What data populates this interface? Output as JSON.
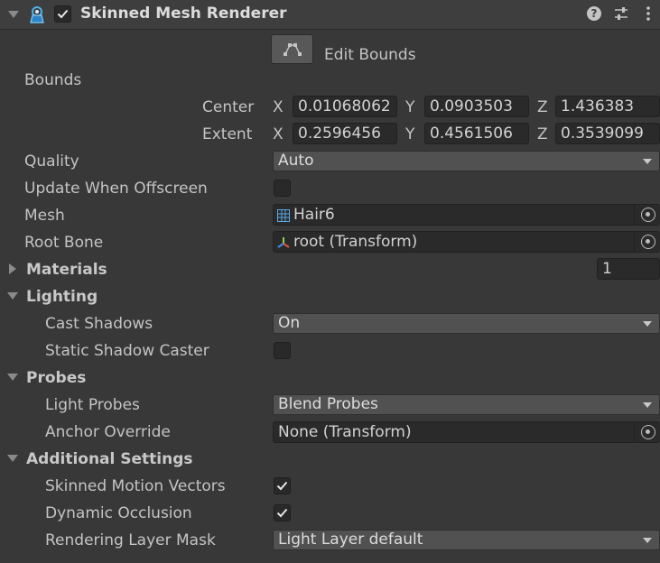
{
  "component": {
    "title": "Skinned Mesh Renderer",
    "enabled": true,
    "header_icons": [
      "help-icon",
      "presets-icon",
      "context-menu-icon"
    ]
  },
  "edit_bounds": {
    "label": "Edit Bounds"
  },
  "bounds": {
    "label": "Bounds",
    "center": {
      "label": "Center",
      "x_label": "X",
      "y_label": "Y",
      "z_label": "Z",
      "x": "0.01068062",
      "y": "0.0903503",
      "z": "1.436383"
    },
    "extent": {
      "label": "Extent",
      "x_label": "X",
      "y_label": "Y",
      "z_label": "Z",
      "x": "0.2596456",
      "y": "0.4561506",
      "z": "0.3539099"
    }
  },
  "quality": {
    "label": "Quality",
    "value": "Auto"
  },
  "update_when_offscreen": {
    "label": "Update When Offscreen",
    "checked": false
  },
  "mesh": {
    "label": "Mesh",
    "value": "Hair6"
  },
  "root_bone": {
    "label": "Root Bone",
    "value": "root (Transform)"
  },
  "materials": {
    "label": "Materials",
    "size": "1",
    "expanded": false
  },
  "lighting": {
    "label": "Lighting",
    "expanded": true,
    "cast_shadows": {
      "label": "Cast Shadows",
      "value": "On"
    },
    "static_shadow_caster": {
      "label": "Static Shadow Caster",
      "checked": false
    }
  },
  "probes": {
    "label": "Probes",
    "expanded": true,
    "light_probes": {
      "label": "Light Probes",
      "value": "Blend Probes"
    },
    "anchor_override": {
      "label": "Anchor Override",
      "value": "None (Transform)"
    }
  },
  "additional_settings": {
    "label": "Additional Settings",
    "expanded": true,
    "skinned_motion_vectors": {
      "label": "Skinned Motion Vectors",
      "checked": true
    },
    "dynamic_occlusion": {
      "label": "Dynamic Occlusion",
      "checked": true
    },
    "rendering_layer_mask": {
      "label": "Rendering Layer Mask",
      "value": "Light Layer default"
    }
  }
}
